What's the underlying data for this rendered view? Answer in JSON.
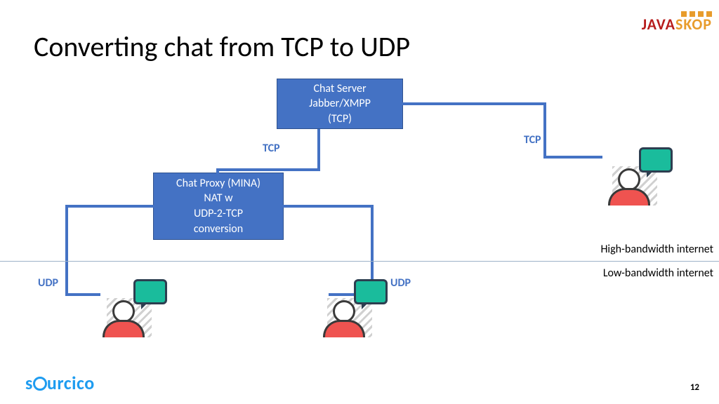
{
  "title": "Converting chat from TCP to UDP",
  "page_number": "12",
  "logo_top": {
    "left": "JAVA",
    "right": "SKOP"
  },
  "logo_bottom": {
    "pre": "s",
    "post": "urcico"
  },
  "boxes": {
    "server": {
      "l1": "Chat Server",
      "l2": "Jabber/XMPP",
      "l3": "(TCP)"
    },
    "proxy": {
      "l1": "Chat Proxy (MINA)",
      "l2": "NAT w",
      "l3": "UDP-2-TCP",
      "l4": "conversion"
    }
  },
  "labels": {
    "tcp_left": "TCP",
    "tcp_right": "TCP",
    "udp_left": "UDP",
    "udp_right": "UDP"
  },
  "bandwidth": {
    "high": "High-bandwidth internet",
    "low": "Low-bandwidth internet"
  }
}
